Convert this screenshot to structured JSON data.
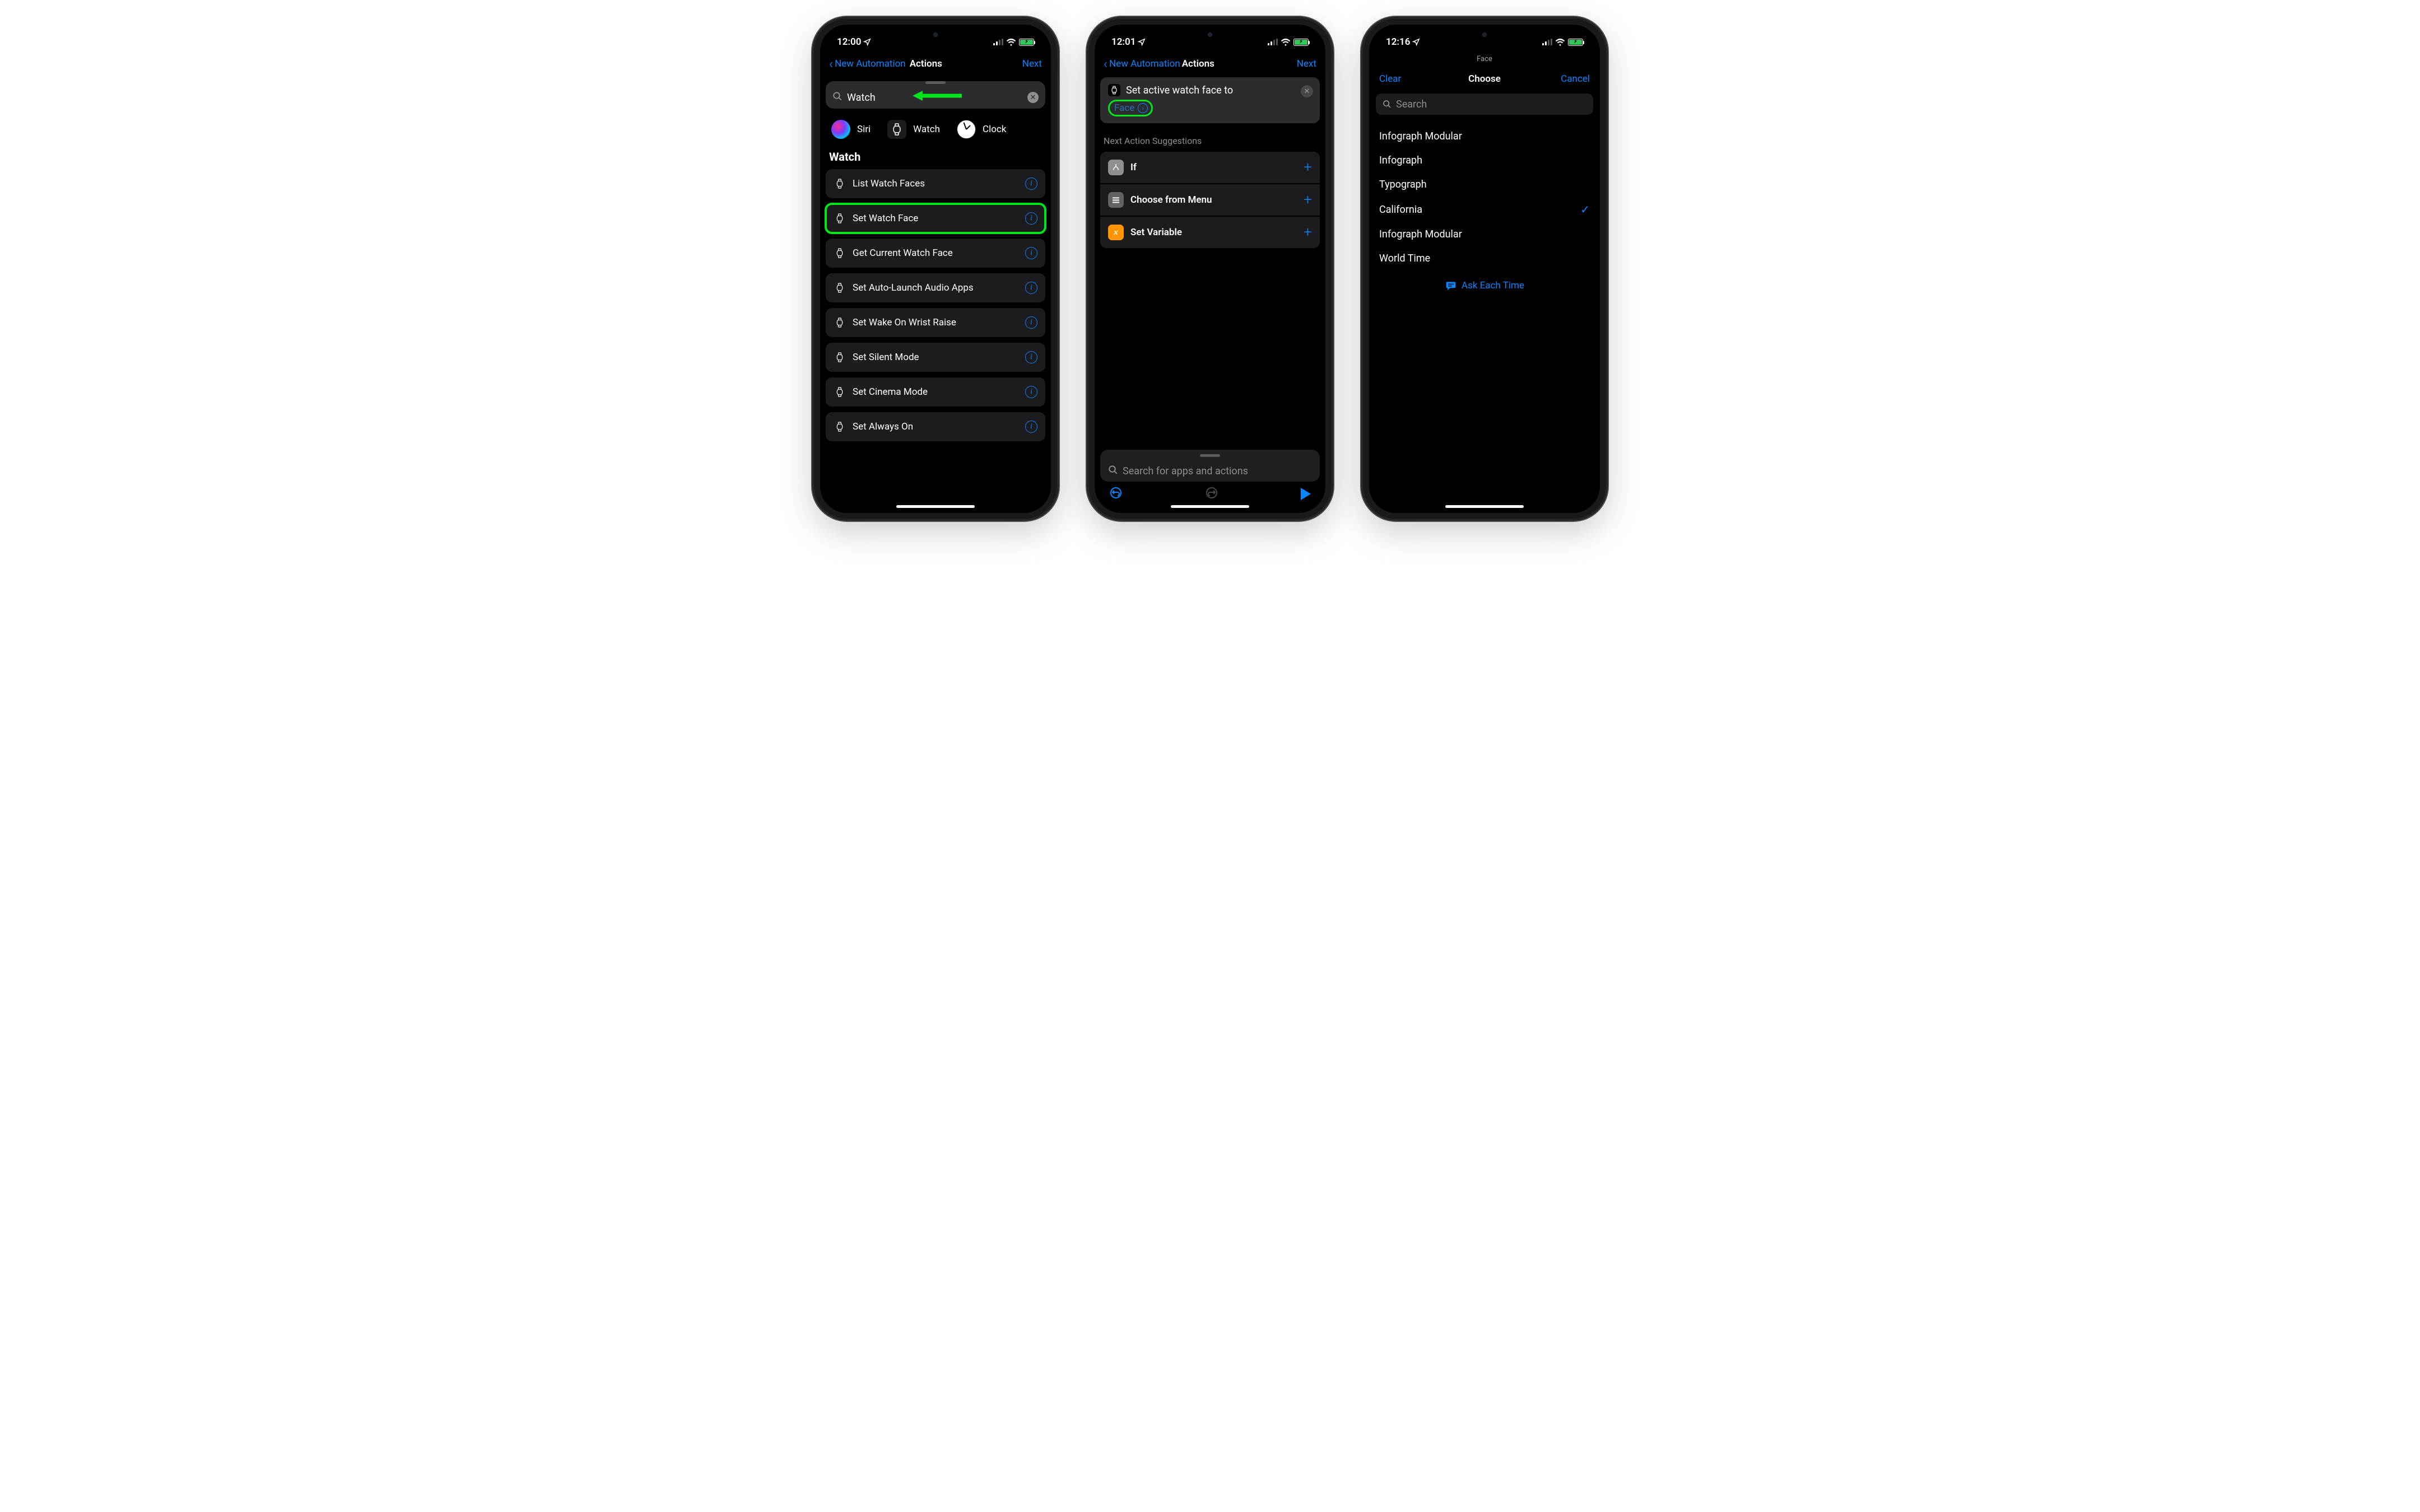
{
  "phone1": {
    "status": {
      "time": "12:00"
    },
    "nav": {
      "back": "New Automation",
      "title": "Actions",
      "next": "Next"
    },
    "search": {
      "value": "Watch"
    },
    "apps": [
      {
        "name": "Siri"
      },
      {
        "name": "Watch"
      },
      {
        "name": "Clock"
      }
    ],
    "section": "Watch",
    "actions": [
      {
        "label": "List Watch Faces"
      },
      {
        "label": "Set Watch Face",
        "highlight": true
      },
      {
        "label": "Get Current Watch Face"
      },
      {
        "label": "Set Auto-Launch Audio Apps"
      },
      {
        "label": "Set Wake On Wrist Raise"
      },
      {
        "label": "Set Silent Mode"
      },
      {
        "label": "Set Cinema Mode"
      },
      {
        "label": "Set Always On"
      }
    ]
  },
  "phone2": {
    "status": {
      "time": "12:01"
    },
    "nav": {
      "back": "New Automation",
      "title": "Actions",
      "next": "Next"
    },
    "card": {
      "text": "Set active watch face to",
      "param": "Face"
    },
    "suggestions_header": "Next Action Suggestions",
    "suggestions": [
      {
        "label": "If",
        "icon": "branch"
      },
      {
        "label": "Choose from Menu",
        "icon": "menu"
      },
      {
        "label": "Set Variable",
        "icon": "var"
      }
    ],
    "bottom_search_placeholder": "Search for apps and actions"
  },
  "phone3": {
    "status": {
      "time": "12:16"
    },
    "header_small": "Face",
    "nav": {
      "left": "Clear",
      "center": "Choose",
      "right": "Cancel"
    },
    "search_placeholder": "Search",
    "faces": [
      {
        "label": "Infograph Modular",
        "selected": false
      },
      {
        "label": "Infograph",
        "selected": false
      },
      {
        "label": "Typograph",
        "selected": false
      },
      {
        "label": "California",
        "selected": true
      },
      {
        "label": "Infograph Modular",
        "selected": false
      },
      {
        "label": "World Time",
        "selected": false
      }
    ],
    "ask": "Ask Each Time"
  }
}
